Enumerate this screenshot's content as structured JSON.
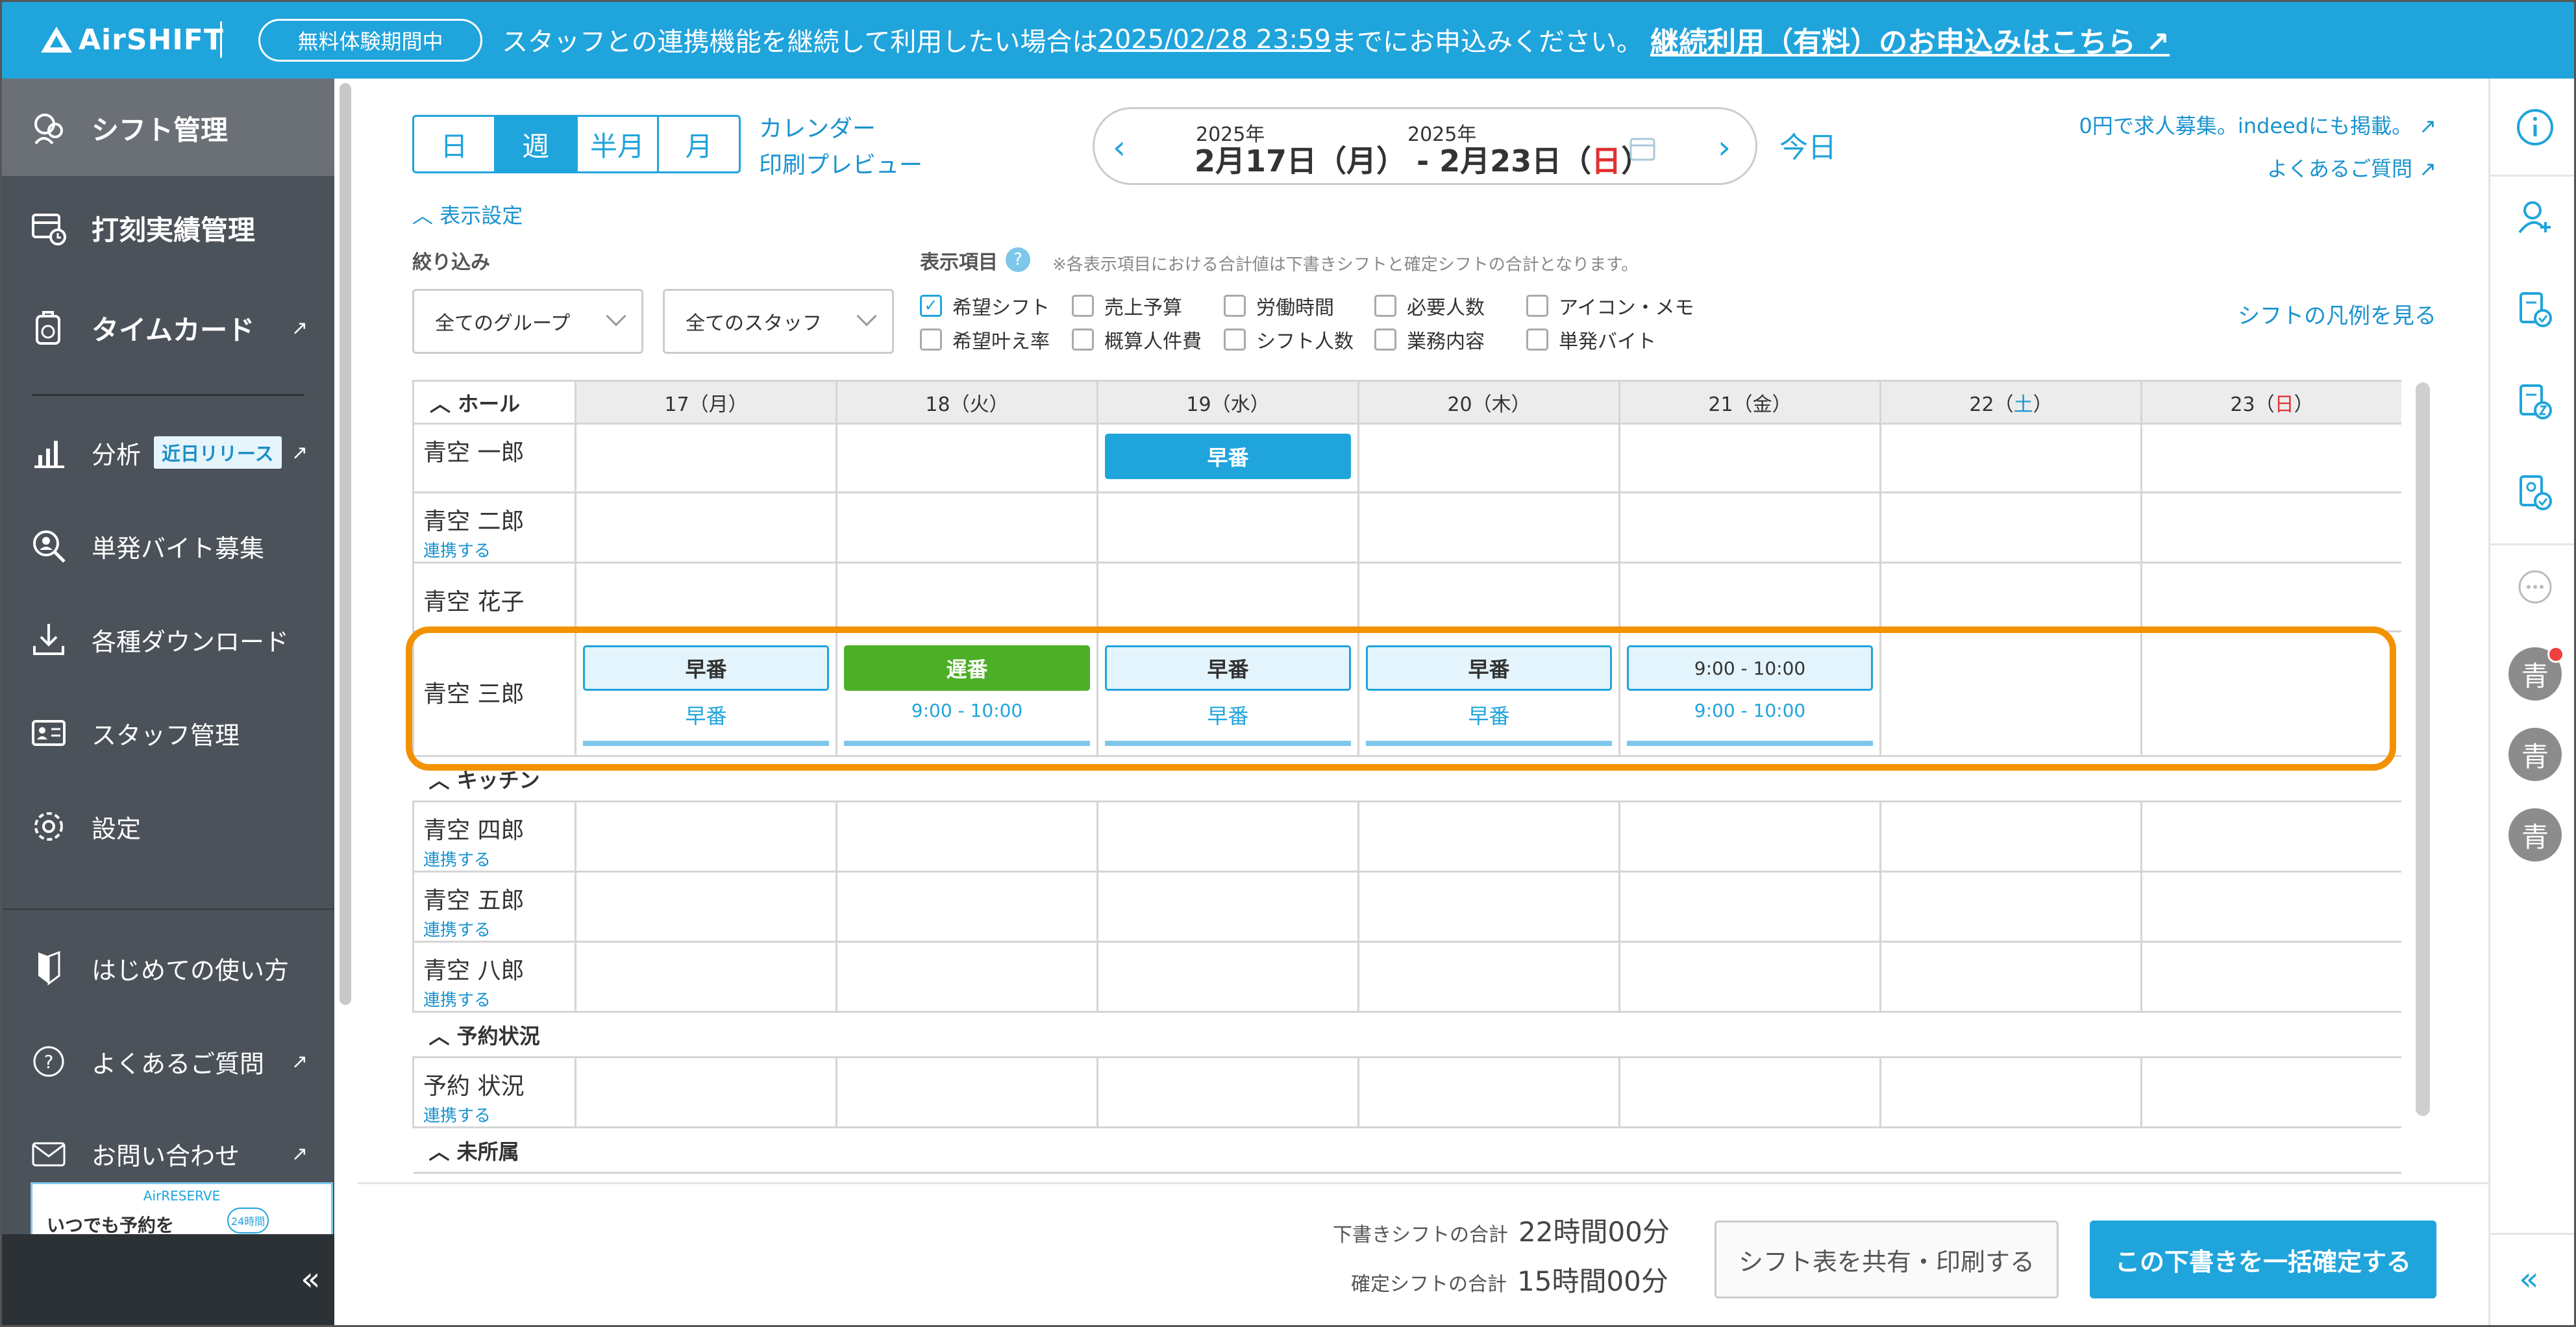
{
  "header": {
    "logo": "AirSHIFT",
    "trial_badge": "無料体験期間中",
    "notice_prefix": "スタッフとの連携機能を継続して利用したい場合は",
    "notice_deadline": "2025/02/28 23:59",
    "notice_suffix": "までにお申込みください。",
    "notice_link": "継続利用（有料）のお申込みはこちら"
  },
  "sidebar": {
    "items": [
      {
        "label": "シフト管理",
        "icon": "shift-icon"
      },
      {
        "label": "打刻実績管理",
        "icon": "clock-record-icon"
      },
      {
        "label": "タイムカード",
        "icon": "timecard-icon"
      },
      {
        "label": "分析",
        "icon": "chart-icon",
        "badge": "近日リリース"
      },
      {
        "label": "単発バイト募集",
        "icon": "recruit-icon"
      },
      {
        "label": "各種ダウンロード",
        "icon": "download-icon"
      },
      {
        "label": "スタッフ管理",
        "icon": "staff-icon"
      },
      {
        "label": "設定",
        "icon": "gear-icon"
      },
      {
        "label": "はじめての使い方",
        "icon": "beginner-icon"
      },
      {
        "label": "よくあるご質問",
        "icon": "question-icon"
      },
      {
        "label": "お問い合わせ",
        "icon": "mail-icon"
      }
    ],
    "banner_brand": "AirRESERVE",
    "banner_text": "いつでも予約を",
    "banner_badge": "24時間",
    "collapse": "«"
  },
  "toolbar": {
    "views": [
      "日",
      "週",
      "半月",
      "月"
    ],
    "active_view": "週",
    "calendar_link": "カレンダー",
    "print_link": "印刷プレビュー",
    "start_year": "2025年",
    "end_year": "2025年",
    "range_start": "2月17日（月）",
    "range_sep": "-",
    "range_end": "2月23日（",
    "range_end_day": "日",
    "range_end_close": "）",
    "today": "今日",
    "job_link": "0円で求人募集。indeedにも掲載。",
    "faq_link": "よくあるご質問"
  },
  "filters": {
    "toggle": "表示設定",
    "filter_label": "絞り込み",
    "group_select": "全てのグループ",
    "staff_select": "全てのスタッフ",
    "items_label": "表示項目",
    "items_note": "※各表示項目における合計値は下書きシフトと確定シフトの合計となります。",
    "checkboxes": [
      {
        "label": "希望シフト",
        "checked": true
      },
      {
        "label": "売上予算",
        "checked": false
      },
      {
        "label": "労働時間",
        "checked": false
      },
      {
        "label": "必要人数",
        "checked": false
      },
      {
        "label": "アイコン・メモ",
        "checked": false
      },
      {
        "label": "希望叶え率",
        "checked": false
      },
      {
        "label": "概算人件費",
        "checked": false
      },
      {
        "label": "シフト人数",
        "checked": false
      },
      {
        "label": "業務内容",
        "checked": false
      },
      {
        "label": "単発バイト",
        "checked": false
      }
    ],
    "legend_link": "シフトの凡例を見る"
  },
  "grid": {
    "days": [
      {
        "num": "17",
        "dow": "月"
      },
      {
        "num": "18",
        "dow": "火"
      },
      {
        "num": "19",
        "dow": "水"
      },
      {
        "num": "20",
        "dow": "木"
      },
      {
        "num": "21",
        "dow": "金"
      },
      {
        "num": "22",
        "dow": "土"
      },
      {
        "num": "23",
        "dow": "日"
      }
    ],
    "groups": {
      "hall": "ホール",
      "kitchen": "キッチン",
      "reservation": "予約状況",
      "unassigned": "未所属"
    },
    "staff": {
      "s1": "青空 一郎",
      "s2": "青空 二郎",
      "s3": "青空 花子",
      "s4": "青空 三郎",
      "s5": "青空 四郎",
      "s6": "青空 五郎",
      "s7": "青空 八郎",
      "res": "予約 状況"
    },
    "link_label": "連携する",
    "shifts": {
      "early": "早番",
      "late": "遅番",
      "time": "9:00 - 10:00"
    }
  },
  "footer": {
    "draft_label": "下書きシフトの合計",
    "draft_value": "22時間00分",
    "confirmed_label": "確定シフトの合計",
    "confirmed_value": "15時間00分",
    "share_button": "シフト表を共有・印刷する",
    "confirm_button": "この下書きを一括確定する"
  },
  "colors": {
    "brand": "#20a4dc",
    "late_shift": "#4caf27",
    "highlight": "#f39200",
    "sunday": "#e03030",
    "saturday": "#1a93cf"
  }
}
